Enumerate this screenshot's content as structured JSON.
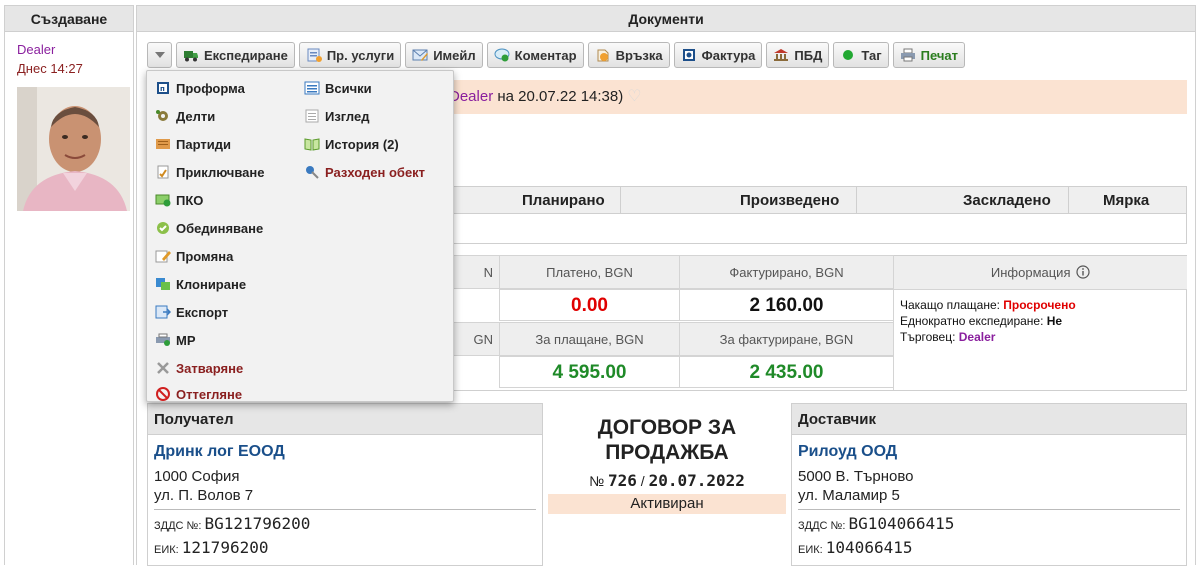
{
  "left": {
    "header": "Създаване",
    "author": "Dealer",
    "date": "Днес 14:27"
  },
  "right": {
    "header": "Документи"
  },
  "toolbar": {
    "items": [
      {
        "label": "Експедиране",
        "icon": "truck-icon"
      },
      {
        "label": "Пр. услуги",
        "icon": "services-icon"
      },
      {
        "label": "Имейл",
        "icon": "email-icon"
      },
      {
        "label": "Коментар",
        "icon": "comment-icon"
      },
      {
        "label": "Връзка",
        "icon": "link-icon"
      },
      {
        "label": "Фактура",
        "icon": "invoice-icon"
      },
      {
        "label": "ПБД",
        "icon": "bank-icon"
      },
      {
        "label": "Таг",
        "icon": "tag-icon"
      },
      {
        "label": "Печат",
        "icon": "print-icon"
      }
    ]
  },
  "notice": {
    "author": "Dealer",
    "text": " на 20.07.22 14:38)"
  },
  "production": {
    "headers": [
      "Планирано",
      "Произведено",
      "Заскладено",
      "Мярка"
    ]
  },
  "finance": {
    "paid_label": "Платено, BGN",
    "paid_value": "0.00",
    "invoiced_label": "Фактурирано, BGN",
    "invoiced_value": "2 160.00",
    "to_pay_label": "За плащане, BGN",
    "to_pay_value": "4 595.00",
    "to_invoice_label": "За фактуриране, BGN",
    "to_invoice_value": "2 435.00",
    "hidden_label_1": "N",
    "hidden_label_2": "GN",
    "info": {
      "title": "Информация",
      "waiting_label": "Чакащо плащане: ",
      "waiting_value": "Просрочено",
      "oneoff_label": "Еднократно експедиране: ",
      "oneoff_value": "Не",
      "trader_label": "Търговец: ",
      "trader_value": "Dealer"
    }
  },
  "recipient": {
    "title": "Получател",
    "name": "Дринк лог ЕООД",
    "city": "1000 София",
    "street": "ул. П. Волов 7",
    "vat_label": "ЗДДС №:",
    "vat": "BG121796200",
    "eik_label": "ЕИК:",
    "eik": "121796200"
  },
  "contract": {
    "title_line1": "ДОГОВОР ЗА",
    "title_line2": "ПРОДАЖБА",
    "num_prefix": "№ ",
    "number": "726",
    "sep": " / ",
    "date": "20.07.2022",
    "status": "Активиран"
  },
  "supplier": {
    "title": "Доставчик",
    "name": "Рилоуд ООД",
    "city": "5000 В. Търново",
    "street": "ул. Маламир 5",
    "vat_label": "ЗДДС №:",
    "vat": "BG104066415",
    "eik_label": "ЕИК:",
    "eik": "104066415"
  },
  "menu": {
    "left_items": [
      {
        "label": "Проформа",
        "icon": "proforma-icon"
      },
      {
        "label": "Делти",
        "icon": "gear-icon"
      },
      {
        "label": "Партиди",
        "icon": "batches-icon"
      },
      {
        "label": "Приключване",
        "icon": "finish-icon"
      },
      {
        "label": "ПКО",
        "icon": "cash-icon"
      },
      {
        "label": "Обединяване",
        "icon": "merge-icon"
      },
      {
        "label": "Промяна",
        "icon": "edit-icon"
      },
      {
        "label": "Клониране",
        "icon": "clone-icon"
      },
      {
        "label": "Експорт",
        "icon": "export-icon"
      },
      {
        "label": "МР",
        "icon": "mr-icon"
      },
      {
        "label": "Затваряне",
        "icon": "close-icon"
      },
      {
        "label": "Оттегляне",
        "icon": "cancel-icon"
      }
    ],
    "right_items": [
      {
        "label": "Всички",
        "icon": "list-icon"
      },
      {
        "label": "Изглед",
        "icon": "view-icon"
      },
      {
        "label": "История (2)",
        "icon": "history-icon"
      },
      {
        "label": "Разходен обект",
        "icon": "pin-icon"
      }
    ]
  }
}
